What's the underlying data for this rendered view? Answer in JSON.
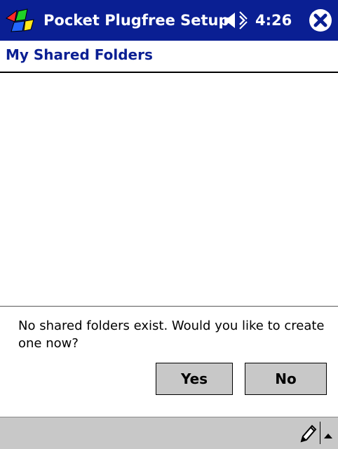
{
  "titlebar": {
    "app_name": "Pocket Plugfree Setup",
    "time": "4:26",
    "start_icon": "windows-flag-icon",
    "volume_icon": "speaker-icon",
    "close_icon": "close-icon"
  },
  "page": {
    "section_title": "My Shared Folders"
  },
  "dialog": {
    "message": "No shared folders exist.  Would you like to create one now?",
    "yes_label": "Yes",
    "no_label": "No"
  },
  "bottombar": {
    "input_icon": "pen-icon",
    "menu_icon": "up-arrow-icon"
  },
  "colors": {
    "titlebar_bg": "#0a1f93",
    "section_title": "#0a1f93",
    "button_bg": "#c8c8c8"
  }
}
